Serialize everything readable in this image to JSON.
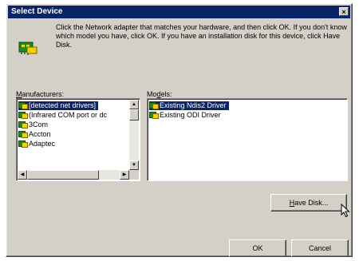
{
  "dialog": {
    "title": "Select Device",
    "close_glyph": "×",
    "instructions": "Click the Network adapter that matches your hardware, and then click OK. If you don't know which model you have, click OK. If you have an installation disk for this device, click Have Disk."
  },
  "manufacturers": {
    "label_prefix": "M",
    "label_rest": "anufacturers:",
    "items": [
      {
        "label": "[detected net drivers]",
        "selected": true
      },
      {
        "label": "(Infrared COM port or dc",
        "selected": false
      },
      {
        "label": "3Com",
        "selected": false
      },
      {
        "label": "Accton",
        "selected": false
      },
      {
        "label": "Adaptec",
        "selected": false
      }
    ]
  },
  "models": {
    "label_prefix": "Mo",
    "label_u": "d",
    "label_rest": "els:",
    "items": [
      {
        "label": "Existing Ndis2 Driver",
        "selected": true
      },
      {
        "label": "Existing ODI Driver",
        "selected": false
      }
    ]
  },
  "buttons": {
    "have_disk_u": "H",
    "have_disk_rest": "ave Disk...",
    "ok": "OK",
    "cancel": "Cancel"
  },
  "icons": {
    "network": "network-card-icon",
    "cursor": "arrow-cursor-icon"
  },
  "colors": {
    "title_bar": "#0a246a",
    "selection": "#0a246a",
    "face": "#d4d0c8"
  }
}
